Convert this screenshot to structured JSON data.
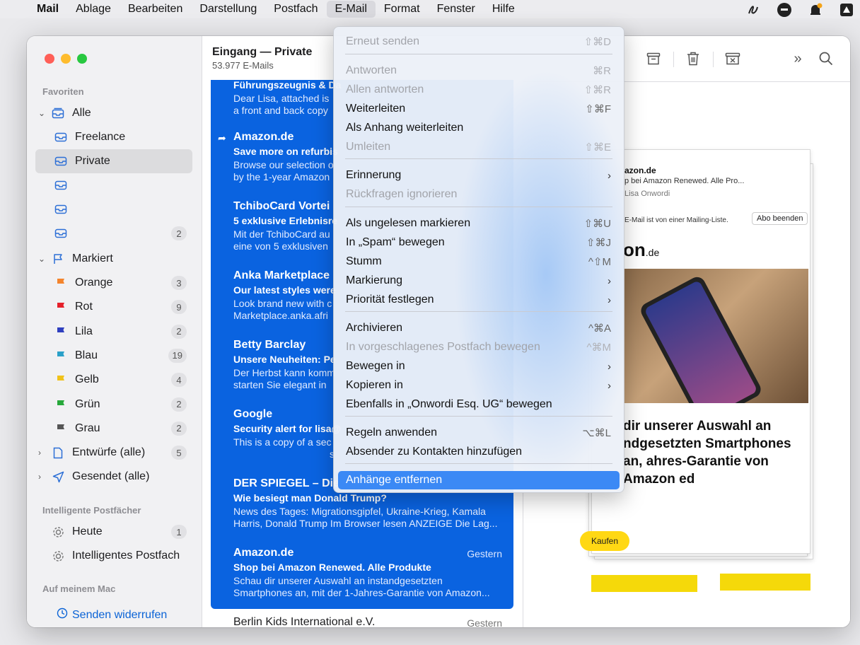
{
  "menubar": {
    "app": "Mail",
    "items": [
      "Ablage",
      "Bearbeiten",
      "Darstellung",
      "Postfach",
      "E-Mail",
      "Format",
      "Fenster",
      "Hilfe"
    ],
    "active": "E-Mail"
  },
  "sidebar": {
    "favorites_title": "Favoriten",
    "all": "Alle",
    "freelance": "Freelance",
    "private": "Private",
    "unnamed_badge": "2",
    "flagged": "Markiert",
    "flags": [
      {
        "label": "Orange",
        "count": "3",
        "color": "#f4842c"
      },
      {
        "label": "Rot",
        "count": "9",
        "color": "#e5202a"
      },
      {
        "label": "Lila",
        "count": "2",
        "color": "#2f3fbf"
      },
      {
        "label": "Blau",
        "count": "19",
        "color": "#2aa0c8"
      },
      {
        "label": "Gelb",
        "count": "4",
        "color": "#f0c21a"
      },
      {
        "label": "Grün",
        "count": "2",
        "color": "#27a83a"
      },
      {
        "label": "Grau",
        "count": "2",
        "color": "#555555"
      }
    ],
    "drafts": "Entwürfe (alle)",
    "drafts_count": "5",
    "sent": "Gesendet (alle)",
    "smart_title": "Intelligente Postfächer",
    "today": "Heute",
    "today_count": "1",
    "smart": "Intelligentes Postfach",
    "mac_title": "Auf meinem Mac",
    "undo_send": "Senden widerrufen"
  },
  "list": {
    "title": "Eingang — Private",
    "count": "53.977 E-Mails",
    "messages": [
      {
        "from": "",
        "subject": "Führungszeugnis & Da",
        "preview1": "Dear Lisa, attached is",
        "preview2": "a front and back copy",
        "date": ""
      },
      {
        "from": "Amazon.de",
        "subject": "Save more on refurbis",
        "preview1": "Browse our selection o",
        "preview2": "by the 1-year Amazon",
        "date": ""
      },
      {
        "from": "TchiboCard Vortei",
        "subject": "5 exklusive Erlebnisre",
        "preview1": "Mit der TchiboCard au",
        "preview2": "eine von 5 exklusiven",
        "date": ""
      },
      {
        "from": "Anka Marketplace",
        "subject": "Our latest styles were",
        "preview1": "Look brand new with c",
        "preview2": "Marketplace.anka.afri",
        "date": ""
      },
      {
        "from": "Betty Barclay",
        "subject": "Unsere Neuheiten: Pe",
        "preview1": "Der Herbst kann komm",
        "preview2": "starten Sie elegant in",
        "date": ""
      },
      {
        "from": "Google",
        "subject": "Security alert for lisa@",
        "preview1": "This is a copy of a sec",
        "preview2": "s",
        "date": ""
      },
      {
        "from": "DER SPIEGEL – Die",
        "subject": "Wie besiegt man Donald Trump?",
        "preview1": "News des Tages: Migrationsgipfel, Ukraine-Krieg, Kamala",
        "preview2": "Harris, Donald Trump Im Browser lesen ANZEIGE Die Lag...",
        "date": ""
      },
      {
        "from": "Amazon.de",
        "subject": "Shop bei Amazon Renewed. Alle Produkte",
        "preview1": "Schau dir unserer Auswahl an instandgesetzten",
        "preview2": "Smartphones an, mit der 1-Jahres-Garantie von Amazon...",
        "date": "Gestern"
      },
      {
        "from": "Berlin Kids International e.V.",
        "subject": "",
        "preview1": "",
        "preview2": "",
        "date": "Gestern"
      }
    ]
  },
  "preview": {
    "sender": "azon.de",
    "subject": "p bei Amazon Renewed. Alle Pro...",
    "to": "Lisa Onwordi",
    "mailing": "E-Mail ist von einer Mailing-Liste.",
    "abo": "Abo beenden",
    "logo": "on",
    "logo_suffix": ".de",
    "headline": "dir unserer Auswahl an ndgesetzten Smartphones an, ahres-Garantie von Amazon ed",
    "button": "Kaufen"
  },
  "menu": {
    "items": [
      {
        "label": "Erneut senden",
        "sc": "⇧⌘D",
        "disabled": true
      },
      {
        "label": "Antworten",
        "sc": "⌘R",
        "disabled": true
      },
      {
        "label": "Allen antworten",
        "sc": "⇧⌘R",
        "disabled": true
      },
      {
        "label": "Weiterleiten",
        "sc": "⇧⌘F",
        "disabled": false
      },
      {
        "label": "Als Anhang weiterleiten",
        "sc": "",
        "disabled": false
      },
      {
        "label": "Umleiten",
        "sc": "⇧⌘E",
        "disabled": true
      },
      {
        "label": "Erinnerung",
        "sc": "›",
        "disabled": false
      },
      {
        "label": "Rückfragen ignorieren",
        "sc": "",
        "disabled": true
      },
      {
        "label": "Als ungelesen markieren",
        "sc": "⇧⌘U",
        "disabled": false
      },
      {
        "label": "In „Spam“ bewegen",
        "sc": "⇧⌘J",
        "disabled": false
      },
      {
        "label": "Stumm",
        "sc": "^⇧M",
        "disabled": false
      },
      {
        "label": "Markierung",
        "sc": "›",
        "disabled": false
      },
      {
        "label": "Priorität festlegen",
        "sc": "›",
        "disabled": false
      },
      {
        "label": "Archivieren",
        "sc": "^⌘A",
        "disabled": false
      },
      {
        "label": "In vorgeschlagenes Postfach bewegen",
        "sc": "^⌘M",
        "disabled": true
      },
      {
        "label": "Bewegen in",
        "sc": "›",
        "disabled": false
      },
      {
        "label": "Kopieren in",
        "sc": "›",
        "disabled": false
      },
      {
        "label": "Ebenfalls in „Onwordi Esq. UG“ bewegen",
        "sc": "",
        "disabled": false
      },
      {
        "label": "Regeln anwenden",
        "sc": "⌥⌘L",
        "disabled": false
      },
      {
        "label": "Absender zu Kontakten hinzufügen",
        "sc": "",
        "disabled": false
      },
      {
        "label": "Anhänge entfernen",
        "sc": "",
        "disabled": false
      }
    ]
  }
}
